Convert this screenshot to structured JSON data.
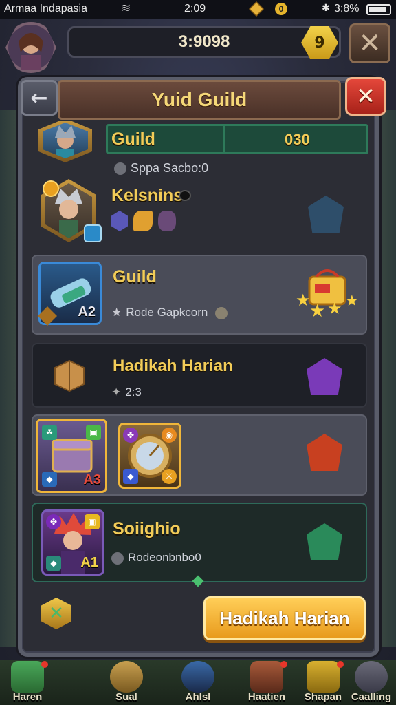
{
  "status_bar": {
    "carrier": "Armaa Indapasia",
    "time": "2:09",
    "coin_label": "0",
    "battery": "3:8%"
  },
  "hud": {
    "currency": "3:9098",
    "level_badge": "9",
    "close_label": "✕"
  },
  "panel": {
    "title": "Yuid Guild",
    "back_label": "←",
    "close_label": "✕"
  },
  "rows": [
    {
      "name": "Guild",
      "value": "030",
      "sub": "Sppa Sacbo:0"
    },
    {
      "name": "Kelsnins",
      "sub_icons": [
        "cube-icon",
        "serpent-icon",
        "shield-icon"
      ]
    },
    {
      "name": "Guild",
      "sub": "Rode Gapkcorn",
      "card_number": "A2"
    },
    {
      "name": "Hadikah Harian",
      "sub": "2:3"
    },
    {
      "card_1_number": "A3",
      "card_2_number": ""
    },
    {
      "name": "Soiighio",
      "sub": "Rodeonbnbo0",
      "card_number": "A1"
    }
  ],
  "footer": {
    "claim_label": "Hadikah Harian"
  },
  "bottom_nav": [
    {
      "label": "Haren",
      "icon": "dragon-icon"
    },
    {
      "label": "Sual",
      "icon": "scroll-icon"
    },
    {
      "label": "Ahlsl",
      "icon": "arrow-icon"
    },
    {
      "label": "Haatien",
      "icon": "chest-icon"
    },
    {
      "label": "Shapan",
      "icon": "cart-icon"
    },
    {
      "label": "Caalling",
      "icon": "wolf-icon"
    }
  ],
  "colors": {
    "gold_text": "#f2cc58",
    "panel_bg": "#2c2d35",
    "claim_button": "#f2b030",
    "close_red": "#d63a2e"
  }
}
